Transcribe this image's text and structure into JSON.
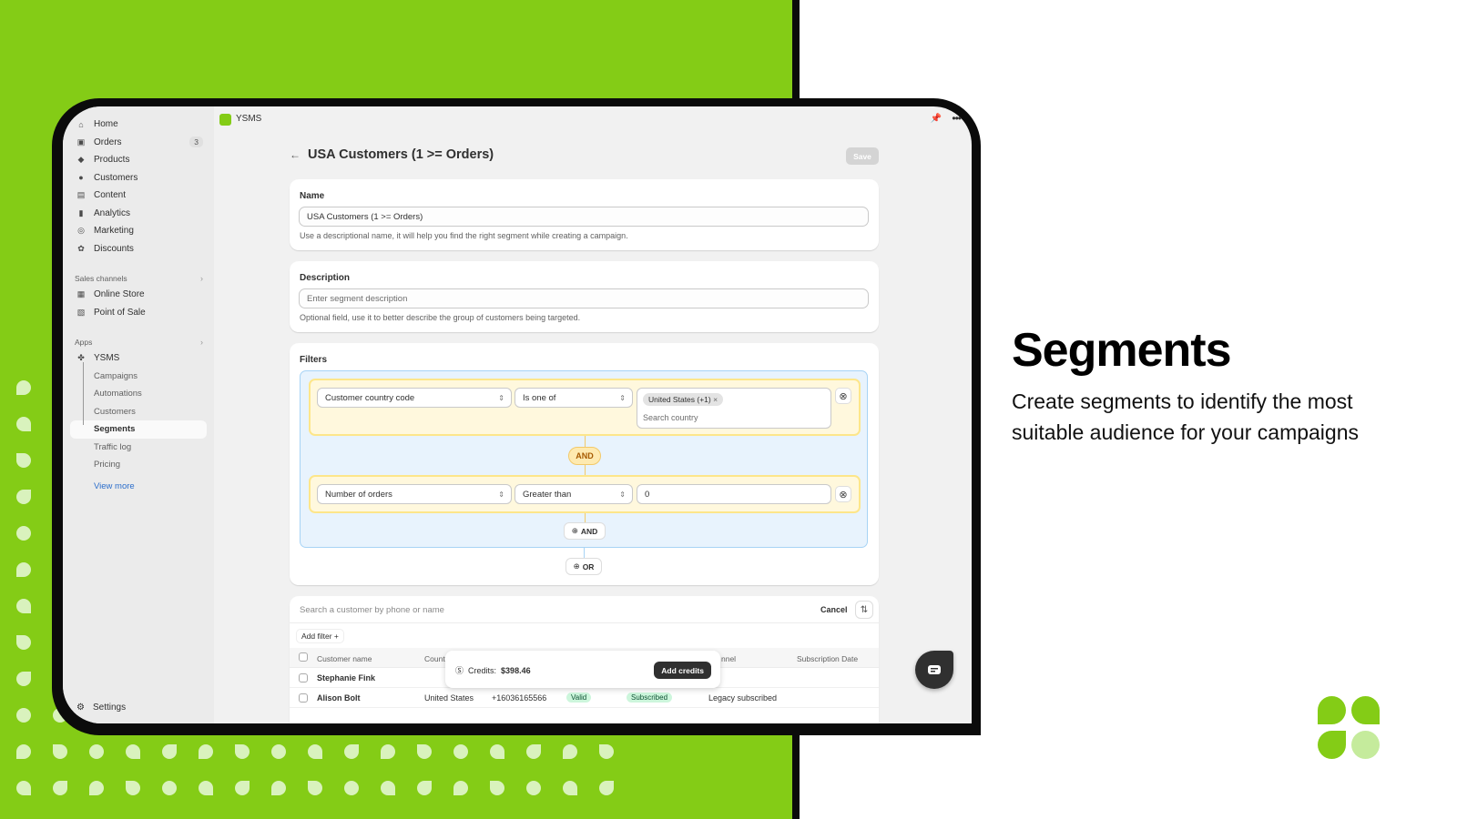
{
  "colors": {
    "brand_green": "#84cc16",
    "light_green": "#d9f2bd",
    "dark": "#0b0b0b"
  },
  "sidebar": {
    "items": [
      {
        "label": "Home",
        "icon": "home-icon"
      },
      {
        "label": "Orders",
        "icon": "inbox-icon",
        "badge": "3"
      },
      {
        "label": "Products",
        "icon": "tag-icon"
      },
      {
        "label": "Customers",
        "icon": "person-icon"
      },
      {
        "label": "Content",
        "icon": "image-icon"
      },
      {
        "label": "Analytics",
        "icon": "bar-chart-icon"
      },
      {
        "label": "Marketing",
        "icon": "target-icon"
      },
      {
        "label": "Discounts",
        "icon": "discount-icon"
      }
    ],
    "sales_channels": {
      "heading": "Sales channels",
      "items": [
        {
          "label": "Online Store",
          "icon": "store-icon"
        },
        {
          "label": "Point of Sale",
          "icon": "pos-icon"
        }
      ]
    },
    "apps": {
      "heading": "Apps",
      "app": "YSMS",
      "sub_items": [
        "Campaigns",
        "Automations",
        "Customers",
        "Segments",
        "Traffic log",
        "Pricing"
      ],
      "active": "Segments",
      "view_more": "View more"
    },
    "settings": "Settings"
  },
  "topbar": {
    "app_name": "YSMS"
  },
  "page": {
    "title": "USA Customers (1 >= Orders)",
    "save_label": "Save",
    "name": {
      "label": "Name",
      "value": "USA Customers (1 >= Orders)",
      "help": "Use a descriptional name, it will help you find the right segment while creating a campaign."
    },
    "description": {
      "label": "Description",
      "placeholder": "Enter segment description",
      "help": "Optional field, use it to better describe the group of customers being targeted."
    },
    "filters": {
      "label": "Filters",
      "rules": [
        {
          "field": "Customer country code",
          "operator": "Is one of",
          "tag": "United States (+1)",
          "search_placeholder": "Search country"
        },
        {
          "field": "Number of orders",
          "operator": "Greater than",
          "value": "0"
        }
      ],
      "joiner": "AND",
      "add_and": "AND",
      "add_or": "OR"
    }
  },
  "customers": {
    "search_placeholder": "Search a customer by phone or name",
    "cancel": "Cancel",
    "add_filter": "Add filter +",
    "columns": [
      "Customer name",
      "Count",
      "nnel",
      "Subscription Date"
    ],
    "rows": [
      {
        "name": "Stephanie Fink"
      },
      {
        "name": "Alison Bolt",
        "country": "United States",
        "phone": "+16036165566",
        "status": "Valid",
        "subscription": "Subscribed",
        "channel": "Legacy subscribed"
      }
    ]
  },
  "credits": {
    "label": "Credits:",
    "amount": "$398.46",
    "button": "Add credits"
  },
  "hero": {
    "title": "Segments",
    "subtitle": "Create segments to identify the most suitable audience for your campaigns"
  }
}
